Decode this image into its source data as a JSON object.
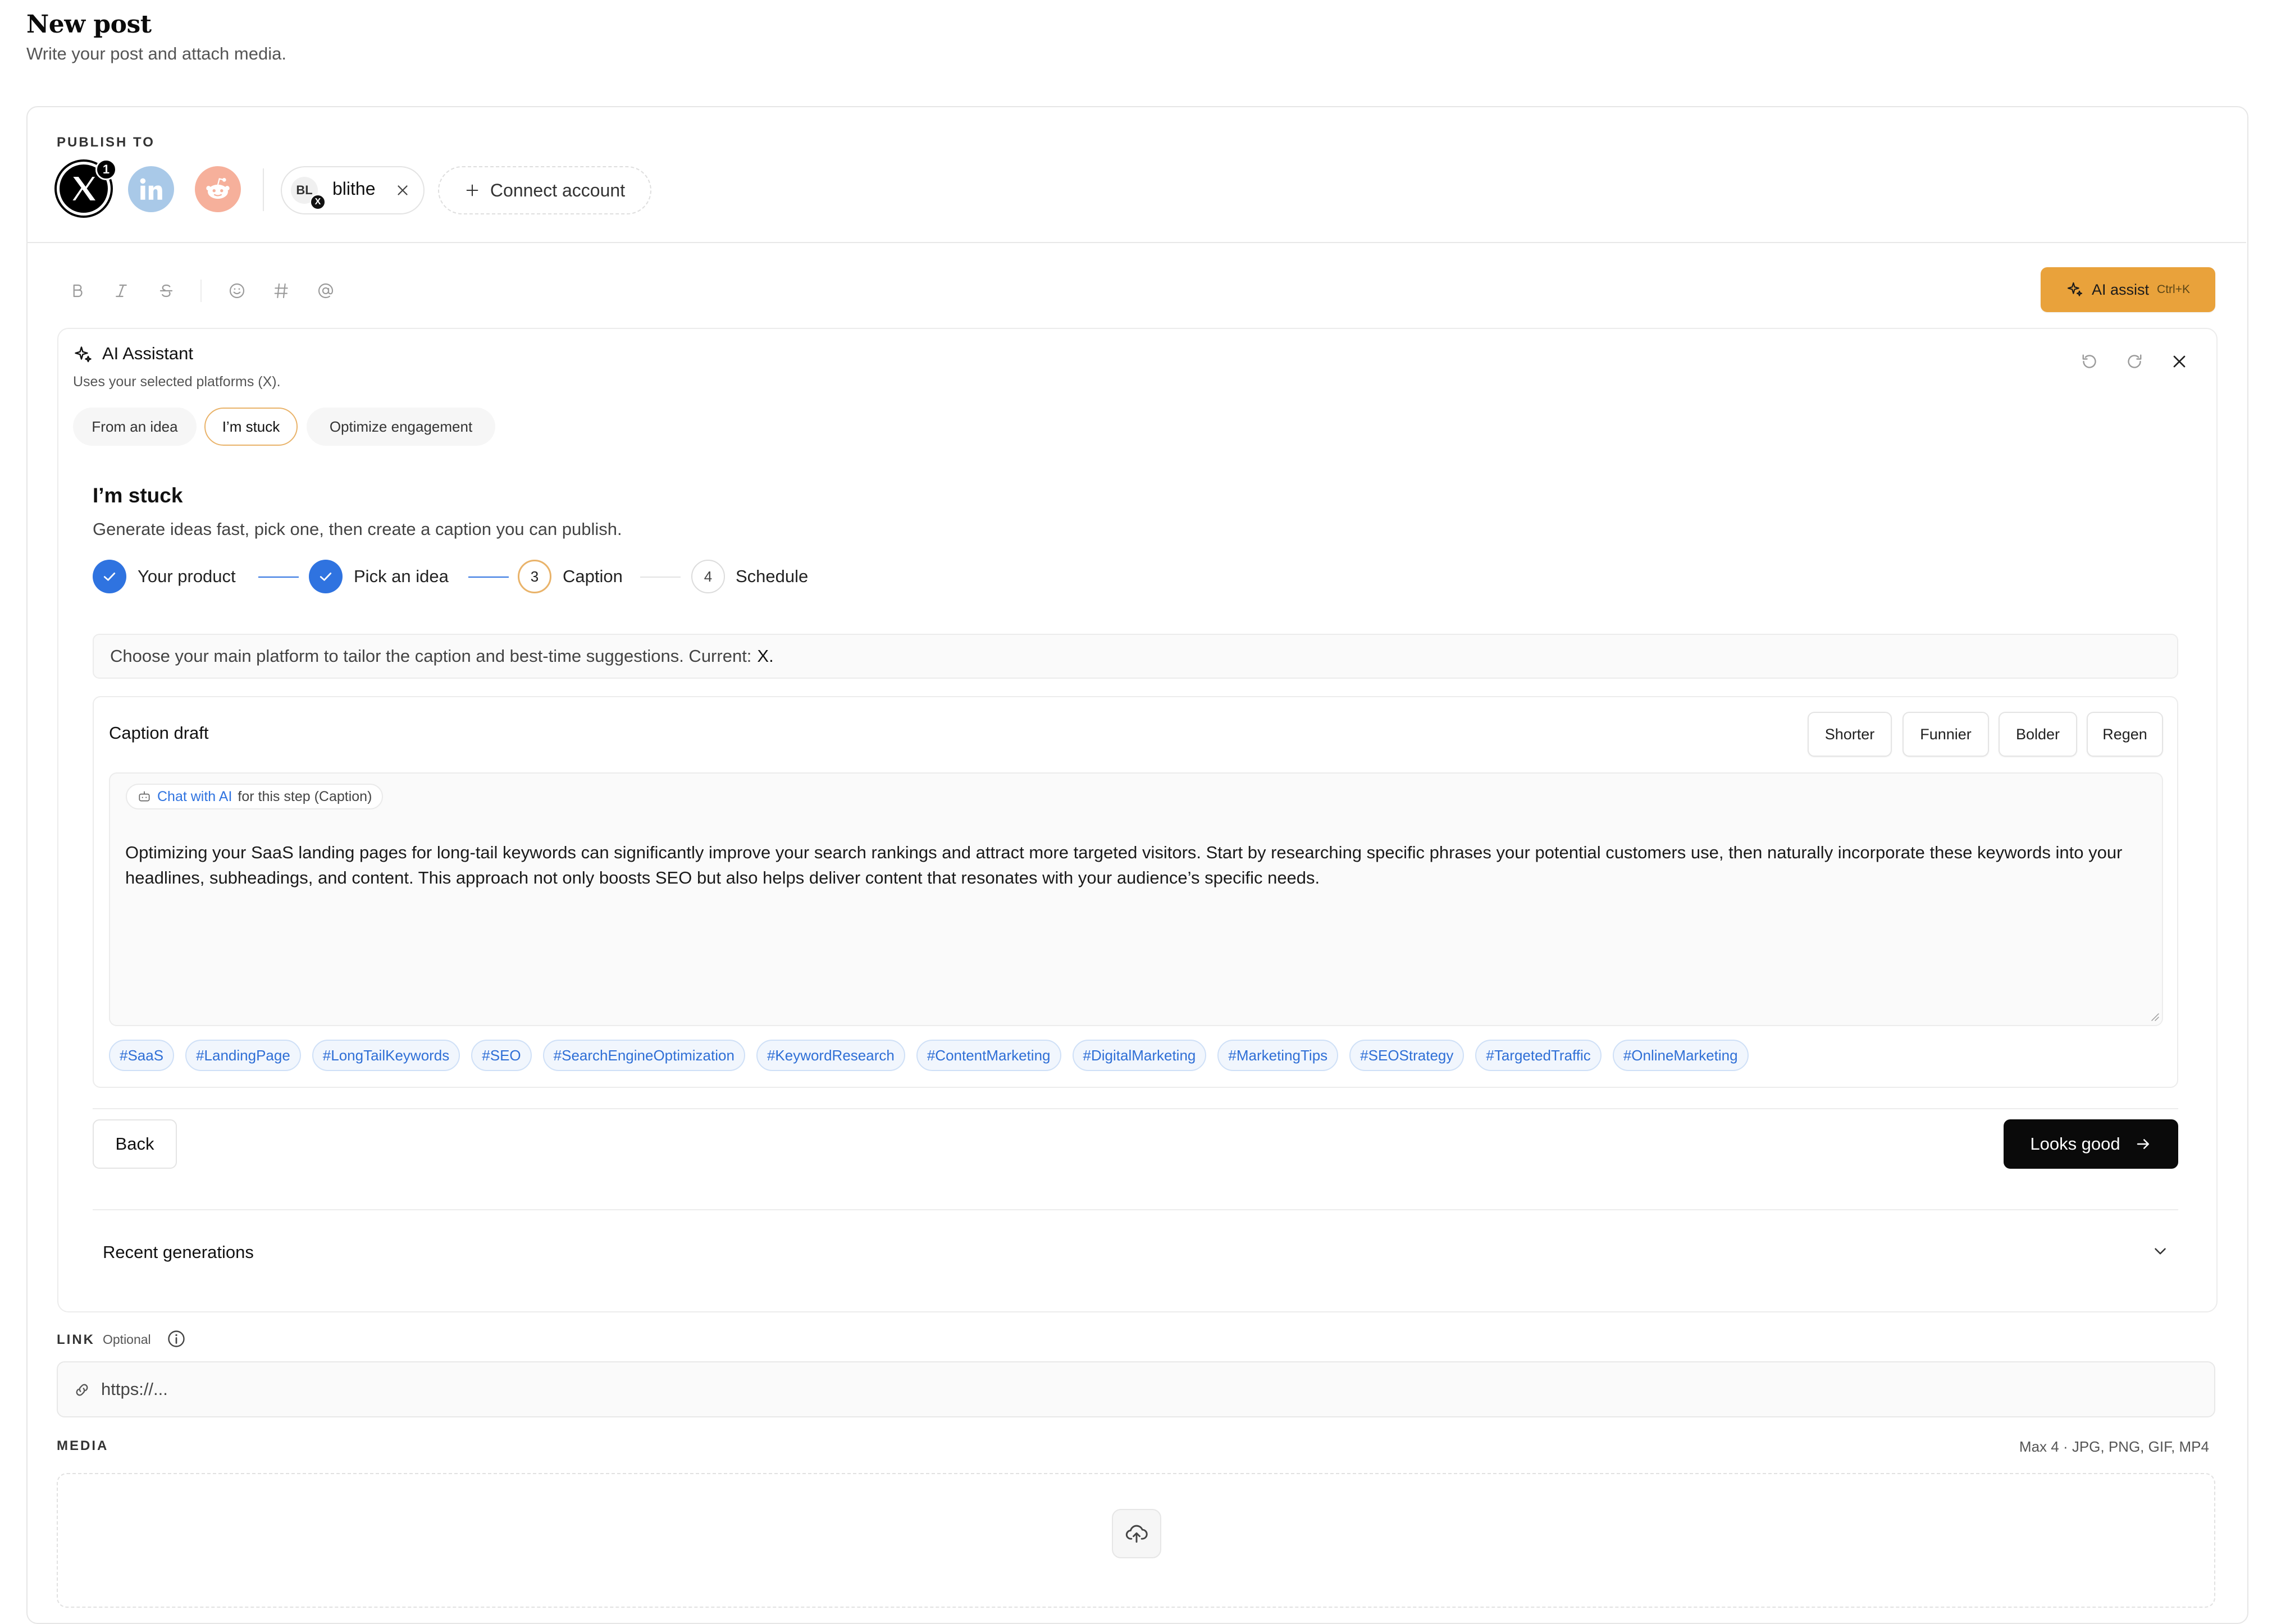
{
  "page": {
    "title": "New post",
    "subtitle": "Write your post and attach media."
  },
  "publish_to": {
    "label": "PUBLISH TO",
    "platforms": [
      {
        "name": "X",
        "selected": true,
        "badge": "1",
        "icon": "x-logo-icon",
        "color": "#000000"
      },
      {
        "name": "LinkedIn",
        "selected": false,
        "icon": "linkedin-icon",
        "color": "#a9c9e8"
      },
      {
        "name": "Reddit",
        "selected": false,
        "icon": "reddit-icon",
        "color": "#f6b09b"
      }
    ],
    "account": {
      "initials": "BL",
      "name": "blithe",
      "platform_badge": "X"
    },
    "connect_label": "Connect account"
  },
  "toolbar": {
    "icons": [
      "bold-icon",
      "italic-icon",
      "strikethrough-icon",
      "emoji-icon",
      "hashtag-icon",
      "mention-icon"
    ],
    "ai_assist_label": "AI assist",
    "ai_assist_shortcut": "Ctrl+K",
    "accent_color": "#e9a23b"
  },
  "ai_assistant": {
    "title": "AI Assistant",
    "subtitle": "Uses your selected platforms (X).",
    "tabs": [
      {
        "label": "From an idea",
        "active": false
      },
      {
        "label": "I’m stuck",
        "active": true
      },
      {
        "label": "Optimize engagement",
        "active": false
      }
    ],
    "step_title": "I’m stuck",
    "step_description": "Generate ideas fast, pick one, then create a caption you can publish.",
    "steps": [
      {
        "label": "Your product",
        "status": "done"
      },
      {
        "label": "Pick an idea",
        "status": "done"
      },
      {
        "label": "Caption",
        "number": "3",
        "status": "current"
      },
      {
        "label": "Schedule",
        "number": "4",
        "status": "upcoming"
      }
    ],
    "platform_banner": {
      "text": "Choose your main platform to tailor the caption and best-time suggestions. Current:",
      "current": "X."
    },
    "caption": {
      "title": "Caption draft",
      "buttons": [
        "Shorter",
        "Funnier",
        "Bolder",
        "Regen"
      ],
      "chat_link": "Chat with AI",
      "chat_suffix": "for this step (Caption)",
      "text": "Optimizing your SaaS landing pages for long-tail keywords can significantly improve your search rankings and attract more targeted visitors. Start by researching specific phrases your potential customers use, then naturally incorporate these keywords into your headlines, subheadings, and content. This approach not only boosts SEO but also helps deliver content that resonates with your audience’s specific needs.",
      "hashtags": [
        "#SaaS",
        "#LandingPage",
        "#LongTailKeywords",
        "#SEO",
        "#SearchEngineOptimization",
        "#KeywordResearch",
        "#ContentMarketing",
        "#DigitalMarketing",
        "#MarketingTips",
        "#SEOStrategy",
        "#TargetedTraffic",
        "#OnlineMarketing"
      ]
    },
    "back_label": "Back",
    "next_label": "Looks good",
    "recent_label": "Recent generations"
  },
  "link": {
    "label": "LINK",
    "optional": "Optional",
    "placeholder": "https://..."
  },
  "media": {
    "label": "MEDIA",
    "hint": "Max 4 · JPG, PNG, GIF, MP4"
  },
  "colors": {
    "primary_blue": "#2f73e0",
    "step_current": "#e9b36a",
    "hashtag_text": "#2f6fd6"
  }
}
